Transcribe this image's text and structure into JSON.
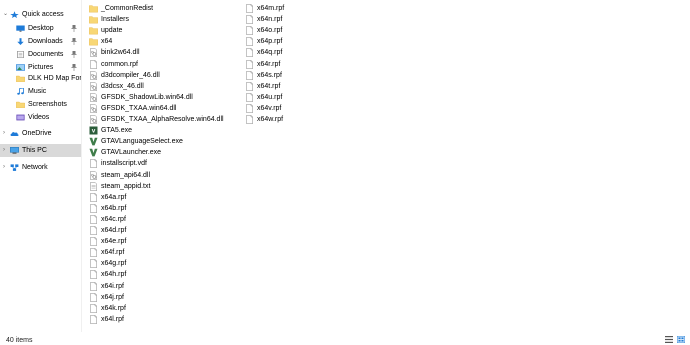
{
  "nav": {
    "items": [
      {
        "label": "Quick access",
        "icon": "star-icon",
        "pinned": false,
        "chevron": "down"
      },
      {
        "label": "Desktop",
        "icon": "desktop-icon",
        "pinned": true
      },
      {
        "label": "Downloads",
        "icon": "download-icon",
        "pinned": true
      },
      {
        "label": "Documents",
        "icon": "documents-icon",
        "pinned": true
      },
      {
        "label": "Pictures",
        "icon": "pictures-icon",
        "pinned": true
      },
      {
        "label": "DLK HD Map For",
        "icon": "folder-icon",
        "pinned": false
      },
      {
        "label": "Music",
        "icon": "music-icon",
        "pinned": false
      },
      {
        "label": "Screenshots",
        "icon": "folder-icon",
        "pinned": false
      },
      {
        "label": "Videos",
        "icon": "videos-icon",
        "pinned": false
      },
      {
        "label": "OneDrive",
        "icon": "onedrive-icon",
        "pinned": false,
        "chevron": "right"
      },
      {
        "label": "This PC",
        "icon": "pc-icon",
        "pinned": false,
        "chevron": "right",
        "selected": true
      },
      {
        "label": "Network",
        "icon": "network-icon",
        "pinned": false,
        "chevron": "right"
      }
    ]
  },
  "files": {
    "column1": [
      {
        "name": "_CommonRedist",
        "type": "folder"
      },
      {
        "name": "Installers",
        "type": "folder"
      },
      {
        "name": "update",
        "type": "folder"
      },
      {
        "name": "x64",
        "type": "folder"
      },
      {
        "name": "bink2w64.dll",
        "type": "dll"
      },
      {
        "name": "common.rpf",
        "type": "file"
      },
      {
        "name": "d3dcompiler_46.dll",
        "type": "dll"
      },
      {
        "name": "d3dcsx_46.dll",
        "type": "dll"
      },
      {
        "name": "GFSDK_ShadowLib.win64.dll",
        "type": "dll"
      },
      {
        "name": "GFSDK_TXAA.win64.dll",
        "type": "dll"
      },
      {
        "name": "GFSDK_TXAA_AlphaResolve.win64.dll",
        "type": "dll"
      },
      {
        "name": "GTA5.exe",
        "type": "exe-gta"
      },
      {
        "name": "GTAVLanguageSelect.exe",
        "type": "exe-v"
      },
      {
        "name": "GTAVLauncher.exe",
        "type": "exe-v"
      },
      {
        "name": "installscript.vdf",
        "type": "file"
      },
      {
        "name": "steam_api64.dll",
        "type": "dll"
      },
      {
        "name": "steam_appid.txt",
        "type": "txt"
      },
      {
        "name": "x64a.rpf",
        "type": "file"
      },
      {
        "name": "x64b.rpf",
        "type": "file"
      },
      {
        "name": "x64c.rpf",
        "type": "file"
      },
      {
        "name": "x64d.rpf",
        "type": "file"
      },
      {
        "name": "x64e.rpf",
        "type": "file"
      },
      {
        "name": "x64f.rpf",
        "type": "file"
      },
      {
        "name": "x64g.rpf",
        "type": "file"
      },
      {
        "name": "x64h.rpf",
        "type": "file"
      },
      {
        "name": "x64i.rpf",
        "type": "file"
      },
      {
        "name": "x64j.rpf",
        "type": "file"
      },
      {
        "name": "x64k.rpf",
        "type": "file"
      },
      {
        "name": "x64l.rpf",
        "type": "file"
      }
    ],
    "column2": [
      {
        "name": "x64m.rpf",
        "type": "file"
      },
      {
        "name": "x64n.rpf",
        "type": "file"
      },
      {
        "name": "x64o.rpf",
        "type": "file"
      },
      {
        "name": "x64p.rpf",
        "type": "file"
      },
      {
        "name": "x64q.rpf",
        "type": "file"
      },
      {
        "name": "x64r.rpf",
        "type": "file"
      },
      {
        "name": "x64s.rpf",
        "type": "file"
      },
      {
        "name": "x64t.rpf",
        "type": "file"
      },
      {
        "name": "x64u.rpf",
        "type": "file"
      },
      {
        "name": "x64v.rpf",
        "type": "file"
      },
      {
        "name": "x64w.rpf",
        "type": "file"
      }
    ]
  },
  "status": {
    "item_count": "40 items"
  },
  "colors": {
    "folder": "#f8d775",
    "folder_dark": "#e8b84a",
    "selected": "#d9d9d9",
    "accent": "#1e7bd8"
  }
}
